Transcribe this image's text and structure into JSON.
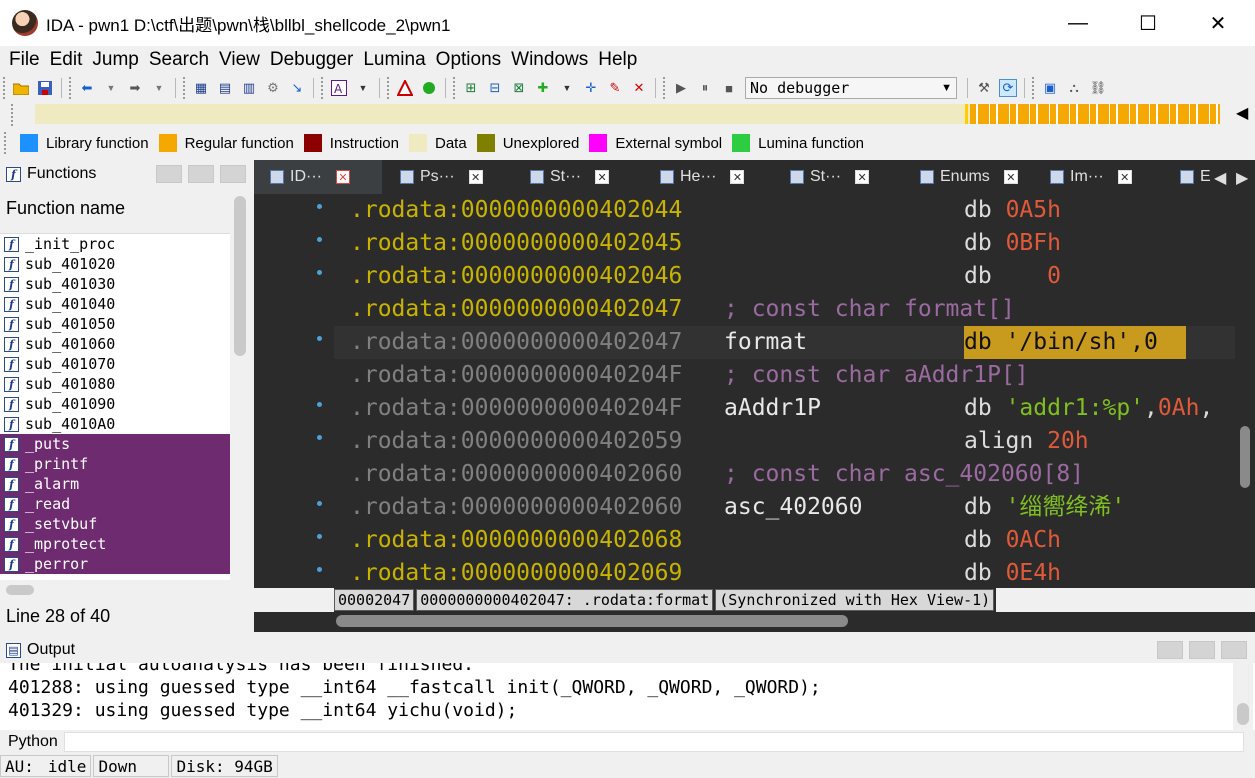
{
  "window": {
    "title": "IDA - pwn1 D:\\ctf\\出题\\pwn\\栈\\bllbl_shellcode_2\\pwn1",
    "minimize": "—",
    "maximize": "☐",
    "close": "✕"
  },
  "menu": [
    "File",
    "Edit",
    "Jump",
    "Search",
    "View",
    "Debugger",
    "Lumina",
    "Options",
    "Windows",
    "Help"
  ],
  "toolbar": {
    "debugger_value": "No debugger",
    "icons": [
      "open-icon",
      "save-icon",
      "back-icon",
      "forward-icon",
      "functions-icon",
      "names-icon",
      "strings-icon",
      "binary-icon",
      "jump-icon",
      "text-color-icon",
      "stop-icon",
      "run-icon",
      "script-icons",
      "play-icon",
      "pause-icon",
      "stop-debug-icon",
      "attach-icon",
      "graph-icon",
      "flowchart-icon"
    ]
  },
  "legend": [
    {
      "label": "Library function",
      "color": "#1e90ff"
    },
    {
      "label": "Regular function",
      "color": "#f4a800"
    },
    {
      "label": "Instruction",
      "color": "#8b0000"
    },
    {
      "label": "Data",
      "color": "#efeac0"
    },
    {
      "label": "Unexplored",
      "color": "#7f7f00"
    },
    {
      "label": "External symbol",
      "color": "#ff00ff"
    },
    {
      "label": "Lumina function",
      "color": "#2ecc40"
    }
  ],
  "functions": {
    "title": "Functions",
    "column": "Function name",
    "items": [
      {
        "name": "_init_proc",
        "lib": false
      },
      {
        "name": "sub_401020",
        "lib": false
      },
      {
        "name": "sub_401030",
        "lib": false
      },
      {
        "name": "sub_401040",
        "lib": false
      },
      {
        "name": "sub_401050",
        "lib": false
      },
      {
        "name": "sub_401060",
        "lib": false
      },
      {
        "name": "sub_401070",
        "lib": false
      },
      {
        "name": "sub_401080",
        "lib": false
      },
      {
        "name": "sub_401090",
        "lib": false
      },
      {
        "name": "sub_4010A0",
        "lib": false
      },
      {
        "name": "_puts",
        "lib": true
      },
      {
        "name": "_printf",
        "lib": true
      },
      {
        "name": "_alarm",
        "lib": true
      },
      {
        "name": "_read",
        "lib": true
      },
      {
        "name": "_setvbuf",
        "lib": true
      },
      {
        "name": "_mprotect",
        "lib": true
      },
      {
        "name": "_perror",
        "lib": true
      }
    ],
    "status": "Line 28 of 40"
  },
  "tabs": [
    {
      "label": "ID···",
      "active": true
    },
    {
      "label": "Ps···",
      "active": false
    },
    {
      "label": "St···",
      "active": false
    },
    {
      "label": "He···",
      "active": false
    },
    {
      "label": "St···",
      "active": false
    },
    {
      "label": "Enums",
      "active": false
    },
    {
      "label": "Im···",
      "active": false
    },
    {
      "label": "E",
      "active": false
    }
  ],
  "listing": [
    {
      "addr": ".rodata:0000000000402044",
      "dim": false,
      "name": "",
      "comment": "",
      "mnem": "db",
      "arg": "0A5h",
      "arg_type": "num",
      "dot": true
    },
    {
      "addr": ".rodata:0000000000402045",
      "dim": false,
      "name": "",
      "comment": "",
      "mnem": "db",
      "arg": "0BFh",
      "arg_type": "num",
      "dot": true
    },
    {
      "addr": ".rodata:0000000000402046",
      "dim": false,
      "name": "",
      "comment": "",
      "mnem": "db",
      "arg": "   0",
      "arg_type": "num",
      "dot": true
    },
    {
      "addr": ".rodata:0000000000402047",
      "dim": false,
      "name": "",
      "comment": "; const char format[]",
      "mnem": "",
      "arg": "",
      "arg_type": "",
      "dot": false
    },
    {
      "addr": ".rodata:0000000000402047",
      "dim": true,
      "name": "format",
      "comment": "",
      "mnem": "db",
      "arg": "'/bin/sh',0",
      "arg_type": "hl",
      "dot": true,
      "current": true
    },
    {
      "addr": ".rodata:000000000040204F",
      "dim": true,
      "name": "",
      "comment": "; const char aAddr1P[]",
      "mnem": "",
      "arg": "",
      "arg_type": "",
      "dot": false
    },
    {
      "addr": ".rodata:000000000040204F",
      "dim": true,
      "name": "aAddr1P",
      "comment": "",
      "mnem": "db",
      "arg": "'addr1:%p',0Ah,",
      "arg_type": "strmix",
      "dot": true
    },
    {
      "addr": ".rodata:0000000000402059",
      "dim": true,
      "name": "",
      "comment": "",
      "mnem": "align",
      "arg": "20h",
      "arg_type": "num",
      "dot": true
    },
    {
      "addr": ".rodata:0000000000402060",
      "dim": true,
      "name": "",
      "comment": "; const char asc_402060[8]",
      "mnem": "",
      "arg": "",
      "arg_type": "",
      "dot": false
    },
    {
      "addr": ".rodata:0000000000402060",
      "dim": true,
      "name": "asc_402060",
      "comment": "",
      "mnem": "db",
      "arg": "'缁嚮绛浠'",
      "arg_type": "str",
      "dot": true
    },
    {
      "addr": ".rodata:0000000000402068",
      "dim": false,
      "name": "",
      "comment": "",
      "mnem": "db",
      "arg": "0ACh",
      "arg_type": "num",
      "dot": true
    },
    {
      "addr": ".rodata:0000000000402069",
      "dim": false,
      "name": "",
      "comment": "",
      "mnem": "db",
      "arg": "0E4h",
      "arg_type": "num",
      "dot": true
    }
  ],
  "disasm_status": {
    "offset": "00002047",
    "location": "0000000000402047: .rodata:format",
    "sync": "(Synchronized with Hex View-1)"
  },
  "output": {
    "title": "Output",
    "lines": [
      "The initial autoanalysis has been finished.",
      "401288: using guessed type __int64 __fastcall init(_QWORD, _QWORD, _QWORD);",
      "401329: using guessed type __int64 yichu(void);"
    ]
  },
  "python_label": "Python",
  "statusbar": {
    "au": "AU:",
    "state": "idle",
    "direction": "Down",
    "disk": "Disk: 94GB"
  }
}
